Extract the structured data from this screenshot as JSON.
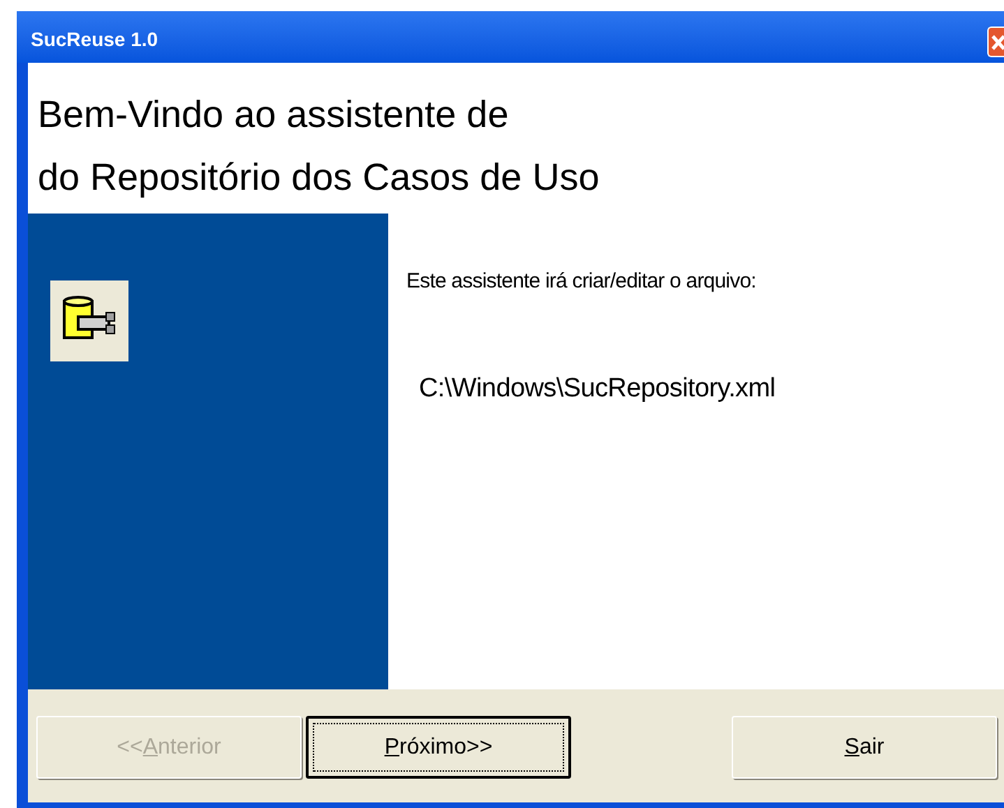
{
  "window": {
    "title": "SucReuse 1.0"
  },
  "heading": [
    "Bem-Vindo ao assistente de",
    "do Repositório dos Casos de Uso"
  ],
  "message": "Este assistente irá criar/editar o arquivo:",
  "file_path": "C:\\Windows\\SucRepository.xml",
  "buttons": [
    {
      "before": "<<",
      "key": "A",
      "after": "nterior",
      "disabled": true,
      "focused": false
    },
    {
      "key": "P",
      "after": "róximo>>",
      "disabled": false,
      "focused": true
    },
    {
      "key": "S",
      "after": "air",
      "disabled": false,
      "focused": false
    }
  ]
}
